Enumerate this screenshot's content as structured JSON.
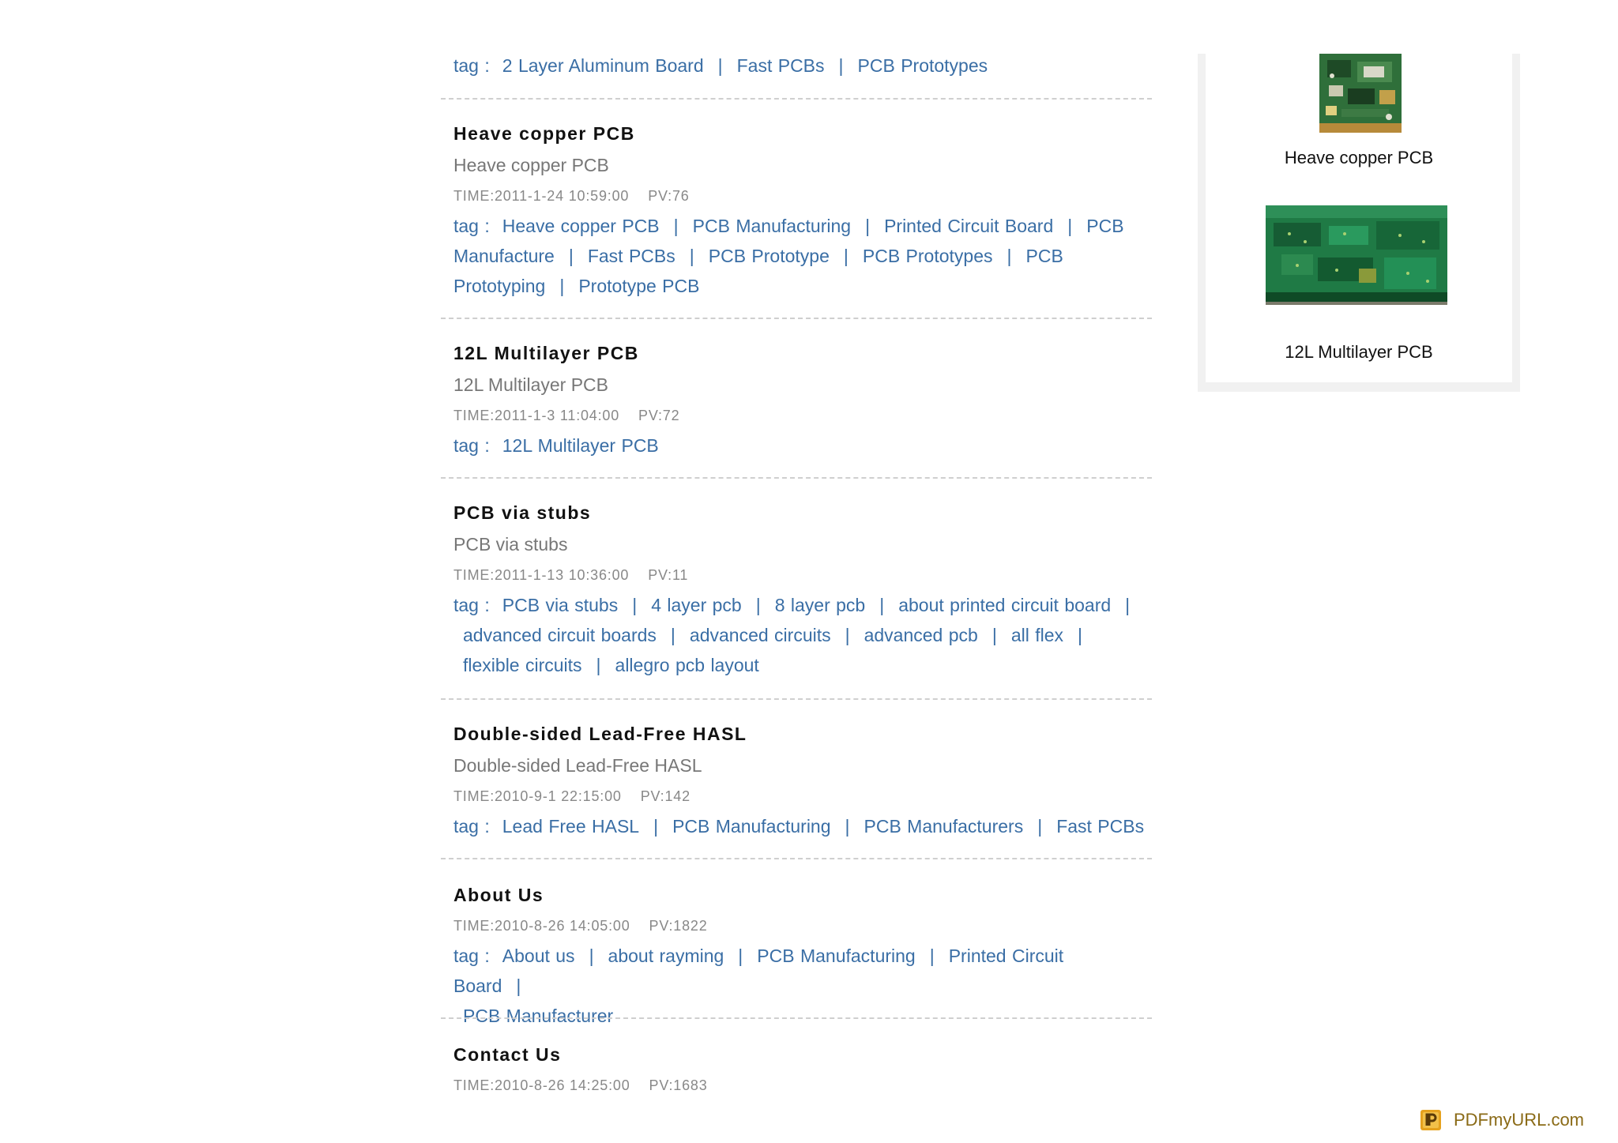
{
  "tag_label": "tag :",
  "first_item_tags": [
    "2 Layer Aluminum Board",
    "Fast PCBs",
    "PCB Prototypes"
  ],
  "articles": [
    {
      "title": "Heave copper PCB",
      "summary": "Heave copper PCB",
      "time": "TIME:2011-1-24 10:59:00",
      "pv": "PV:76",
      "tags": [
        "Heave copper PCB",
        "PCB Manufacturing",
        "Printed Circuit Board",
        "PCB Manufacture",
        "Fast PCBs",
        "PCB Prototype",
        "PCB Prototypes",
        "PCB Prototyping",
        "Prototype PCB"
      ]
    },
    {
      "title": "12L Multilayer PCB",
      "summary": "12L Multilayer PCB",
      "time": "TIME:2011-1-3 11:04:00",
      "pv": "PV:72",
      "tags": [
        "12L Multilayer PCB"
      ]
    },
    {
      "title": "PCB via stubs",
      "summary": "PCB via stubs",
      "time": "TIME:2011-1-13 10:36:00",
      "pv": "PV:11",
      "tags": [
        "PCB via stubs",
        "4 layer pcb",
        "8 layer pcb",
        "about printed circuit board",
        "advanced circuit boards",
        "advanced circuits",
        "advanced pcb",
        "all flex",
        "flexible circuits",
        "allegro pcb layout"
      ]
    },
    {
      "title": "Double-sided Lead-Free HASL",
      "summary": "Double-sided Lead-Free HASL",
      "time": "TIME:2010-9-1 22:15:00",
      "pv": "PV:142",
      "tags": [
        "Lead Free HASL",
        "PCB Manufacturing",
        "PCB Manufacturers",
        "Fast PCBs"
      ]
    },
    {
      "title": "About Us",
      "summary": "",
      "time": "TIME:2010-8-26 14:05:00",
      "pv": "PV:1822",
      "tags": [
        "About us",
        "about rayming",
        "PCB Manufacturing",
        "Printed Circuit Board",
        "PCB Manufacturer"
      ]
    },
    {
      "title": "Contact Us",
      "summary": "",
      "time": "TIME:2010-8-26 14:25:00",
      "pv": "PV:1683",
      "tags": []
    }
  ],
  "sidebar": {
    "products": [
      {
        "caption": "Heave copper PCB",
        "image_icon": "pcb-board-photo"
      },
      {
        "caption": "12L Multilayer PCB",
        "image_icon": "pcb-board-photo"
      }
    ]
  },
  "branding": {
    "name": "PDFmyURL.com",
    "logo_icon": "pdfmyurl-logo-icon",
    "color": "#8a6a16"
  },
  "colors": {
    "link": "#3a6ea5",
    "title": "#111111",
    "summary": "#777777",
    "meta": "#888888"
  }
}
